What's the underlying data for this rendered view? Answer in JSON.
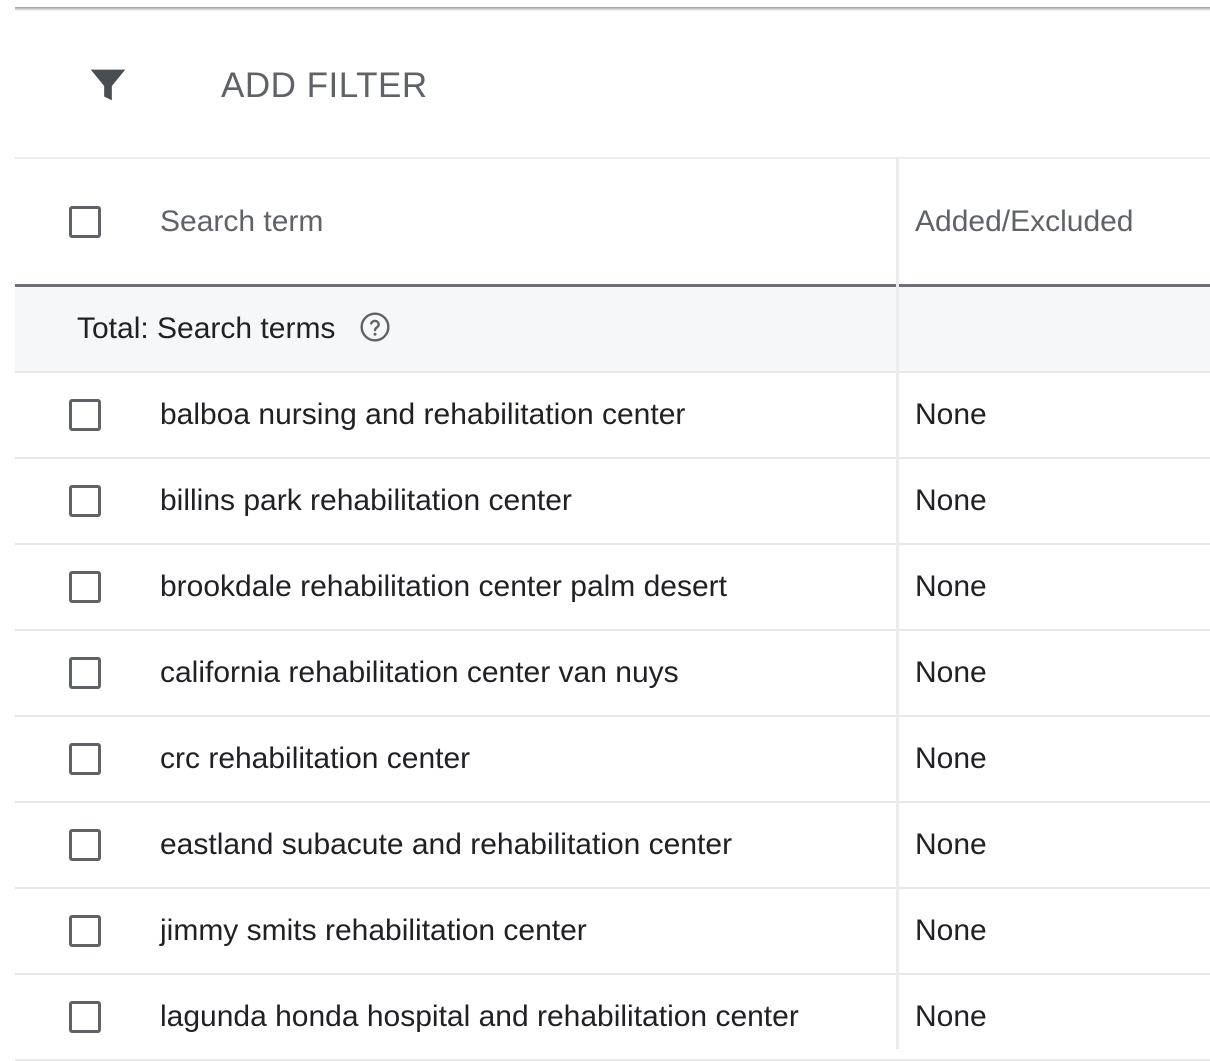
{
  "filter": {
    "label": "ADD FILTER",
    "icon": "filter-icon"
  },
  "table": {
    "headers": {
      "search_term": "Search term",
      "added_excluded": "Added/Excluded"
    },
    "total": {
      "label": "Total: Search terms",
      "help_icon": "help-circle-icon"
    },
    "rows": [
      {
        "term": "balboa nursing and rehabilitation center",
        "added": "None"
      },
      {
        "term": "billins park rehabilitation center",
        "added": "None"
      },
      {
        "term": "brookdale rehabilitation center palm desert",
        "added": "None"
      },
      {
        "term": "california rehabilitation center van nuys",
        "added": "None"
      },
      {
        "term": "crc rehabilitation center",
        "added": "None"
      },
      {
        "term": "eastland subacute and rehabilitation center",
        "added": "None"
      },
      {
        "term": "jimmy smits rehabilitation center",
        "added": "None"
      },
      {
        "term": "lagunda honda hospital and rehabilitation center",
        "added": "None"
      }
    ]
  },
  "colors": {
    "text_primary": "#202124",
    "text_secondary": "#5f6368",
    "total_row_bg": "#f6f7f8"
  }
}
